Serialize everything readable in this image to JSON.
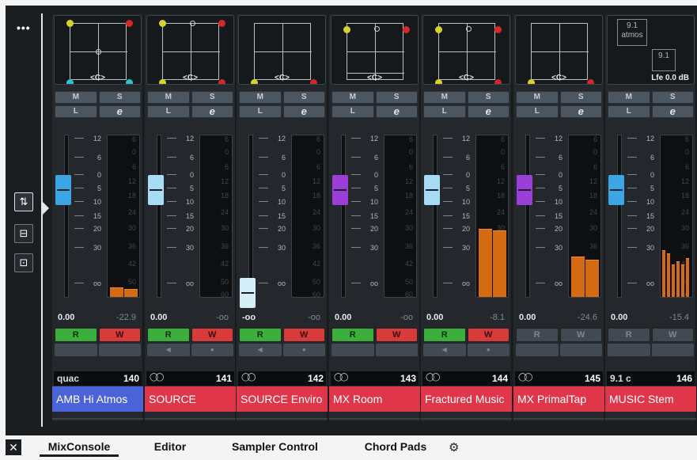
{
  "sidebar": {
    "more": "•••"
  },
  "tabs": [
    {
      "label": "MixConsole"
    },
    {
      "label": "Editor"
    },
    {
      "label": "Sampler Control"
    },
    {
      "label": "Chord Pads"
    }
  ],
  "labels": {
    "mute": "M",
    "solo": "S",
    "listen": "L",
    "edit": "e",
    "read": "R",
    "write": "W"
  },
  "scale": [
    "12",
    "6",
    "0",
    "5",
    "10",
    "15",
    "20",
    "30",
    "oo"
  ],
  "meter_scale": [
    "6",
    "0",
    "6",
    "12",
    "18",
    "24",
    "30",
    "36",
    "42",
    "50",
    "60"
  ],
  "strips": [
    {
      "panner_label": "<C>",
      "info_text": "quac",
      "number": "140",
      "name": "AMB Hi Atmos",
      "fader_value": "0.00",
      "peak_value": "-22.9",
      "fader_pos": 0.34,
      "knob_color": "#3aa6e6",
      "name_color": "#4a63d8",
      "rw_active": true,
      "meter_levels": [
        0.06,
        0.05
      ]
    },
    {
      "panner_label": "<C>",
      "info_text": "",
      "number": "141",
      "name": "SOURCE",
      "fader_value": "0.00",
      "peak_value": "-oo",
      "fader_pos": 0.34,
      "knob_color": "#a6dcf5",
      "name_color": "#e0364a",
      "rw_active": true,
      "meter_levels": [
        0,
        0
      ]
    },
    {
      "panner_label": "<C>",
      "info_text": "",
      "number": "142",
      "name": "SOURCE Enviro",
      "fader_value": "-oo",
      "peak_value": "-oo",
      "fader_pos": 0.97,
      "knob_color": "#d4eef8",
      "name_color": "#e0364a",
      "rw_active": true,
      "meter_levels": [
        0,
        0
      ]
    },
    {
      "panner_label": "<C>",
      "info_text": "",
      "number": "143",
      "name": "MX Room",
      "fader_value": "0.00",
      "peak_value": "-oo",
      "fader_pos": 0.34,
      "knob_color": "#9c3fd8",
      "name_color": "#e0364a",
      "rw_active": true,
      "meter_levels": [
        0,
        0
      ]
    },
    {
      "panner_label": "<C>",
      "info_text": "",
      "number": "144",
      "name": "Fractured Music",
      "fader_value": "0.00",
      "peak_value": "-8.1",
      "fader_pos": 0.34,
      "knob_color": "#a6dcf5",
      "name_color": "#e0364a",
      "rw_active": true,
      "meter_levels": [
        0.42,
        0.41
      ]
    },
    {
      "panner_label": "<C>",
      "info_text": "",
      "number": "145",
      "name": "MX PrimalTap",
      "fader_value": "0.00",
      "peak_value": "-24.6",
      "fader_pos": 0.34,
      "knob_color": "#9c3fd8",
      "name_color": "#e0364a",
      "rw_active": false,
      "meter_levels": [
        0.25,
        0.23
      ]
    },
    {
      "panner_label": "9.1 atmos",
      "info_text": "9.1 c",
      "number": "146",
      "name": "MUSIC Stem",
      "fader_value": "0.00",
      "peak_value": "-15.4",
      "fader_pos": 0.34,
      "knob_color": "#3aa6e6",
      "name_color": "#e0364a",
      "rw_active": false,
      "meter_levels": [
        0.29,
        0.27,
        0.2,
        0.22,
        0.2,
        0.24
      ],
      "atmos_box_2": "9.1",
      "lfe_label": "Lfe 0.0 dB"
    }
  ]
}
